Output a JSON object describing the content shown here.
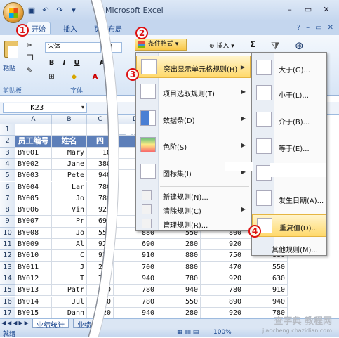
{
  "titlebar": {
    "title": "Microsoft Excel"
  },
  "tabs": {
    "home": "开始",
    "insert": "插入",
    "page_layout": "页面布局"
  },
  "ribbon": {
    "paste": "粘贴",
    "clipboard_group": "剪贴板",
    "font_group": "字体",
    "font_name": "宋体",
    "font_size": "11",
    "conditional_format": "条件格式",
    "insert": "插入",
    "sigma": "Σ",
    "bold": "B",
    "italic": "I",
    "underline": "U",
    "grow_font": "A"
  },
  "formula_bar": {
    "name_box": "K23"
  },
  "grid": {
    "columns": [
      "A",
      "B",
      "C",
      "D",
      "E",
      "F",
      "G"
    ],
    "title_fragment": "二季业",
    "headers": [
      "员工编号",
      "姓名",
      "四"
    ],
    "rows": [
      [
        "BY001",
        "Mary",
        "10",
        "",
        "",
        "",
        ""
      ],
      [
        "BY002",
        "Jane",
        "380",
        "",
        "",
        "",
        ""
      ],
      [
        "BY003",
        "Pete",
        "940",
        "",
        "",
        "",
        ""
      ],
      [
        "BY004",
        "Lar",
        "780",
        "",
        "",
        "",
        ""
      ],
      [
        "BY005",
        "Jo",
        "780",
        "",
        "",
        "",
        ""
      ],
      [
        "BY006",
        "Vin",
        "920",
        "",
        "",
        "",
        ""
      ],
      [
        "BY007",
        "Pr",
        "690",
        "",
        "",
        "",
        ""
      ],
      [
        "BY008",
        "Jo",
        "550",
        "880",
        "550",
        "800",
        ""
      ],
      [
        "BY009",
        "Al",
        "920",
        "690",
        "280",
        "920",
        "880"
      ],
      [
        "BY010",
        "C",
        "920",
        "910",
        "880",
        "750",
        "880"
      ],
      [
        "BY011",
        "J",
        "280",
        "700",
        "880",
        "470",
        "550"
      ],
      [
        "BY012",
        "T",
        "780",
        "940",
        "780",
        "920",
        "630"
      ],
      [
        "BY013",
        "Patr",
        "690",
        "780",
        "940",
        "780",
        "910"
      ],
      [
        "BY014",
        "Jul",
        "880",
        "780",
        "550",
        "890",
        "940"
      ],
      [
        "BY015",
        "Dann",
        "920",
        "940",
        "280",
        "920",
        "780"
      ]
    ],
    "row_numbers": [
      "1",
      "2",
      "3",
      "4",
      "5",
      "6",
      "7",
      "8",
      "9",
      "10",
      "11",
      "12",
      "13",
      "14",
      "15",
      "16",
      "17"
    ]
  },
  "sheets": {
    "active": "业绩统计",
    "second": "业绩"
  },
  "status": {
    "ready": "就绪",
    "zoom": "100%"
  },
  "menu": {
    "items": [
      {
        "label": "突出显示单元格规则(H)",
        "icon": "highlight-rules-icon"
      },
      {
        "label": "项目选取规则(T)",
        "icon": "top-bottom-icon"
      },
      {
        "label": "数据条(D)",
        "icon": "data-bars-icon"
      },
      {
        "label": "色阶(S)",
        "icon": "color-scales-icon"
      },
      {
        "label": "图标集(I)",
        "icon": "icon-sets-icon"
      }
    ],
    "commands": [
      "新建规则(N)...",
      "清除规则(C)",
      "管理规则(R)..."
    ]
  },
  "submenu": {
    "items": [
      {
        "label": "大于(G)..."
      },
      {
        "label": "小于(L)..."
      },
      {
        "label": "介于(B)..."
      },
      {
        "label": "等于(E)..."
      },
      {
        "label": ""
      },
      {
        "label": "发生日期(A)..."
      },
      {
        "label": "重复值(D)..."
      }
    ],
    "more": "其他规则(M)..."
  },
  "callouts": [
    "1",
    "2",
    "3",
    "4"
  ],
  "watermark": {
    "text": "查字典 教程网",
    "url": "jiaocheng.chazidian.com"
  }
}
